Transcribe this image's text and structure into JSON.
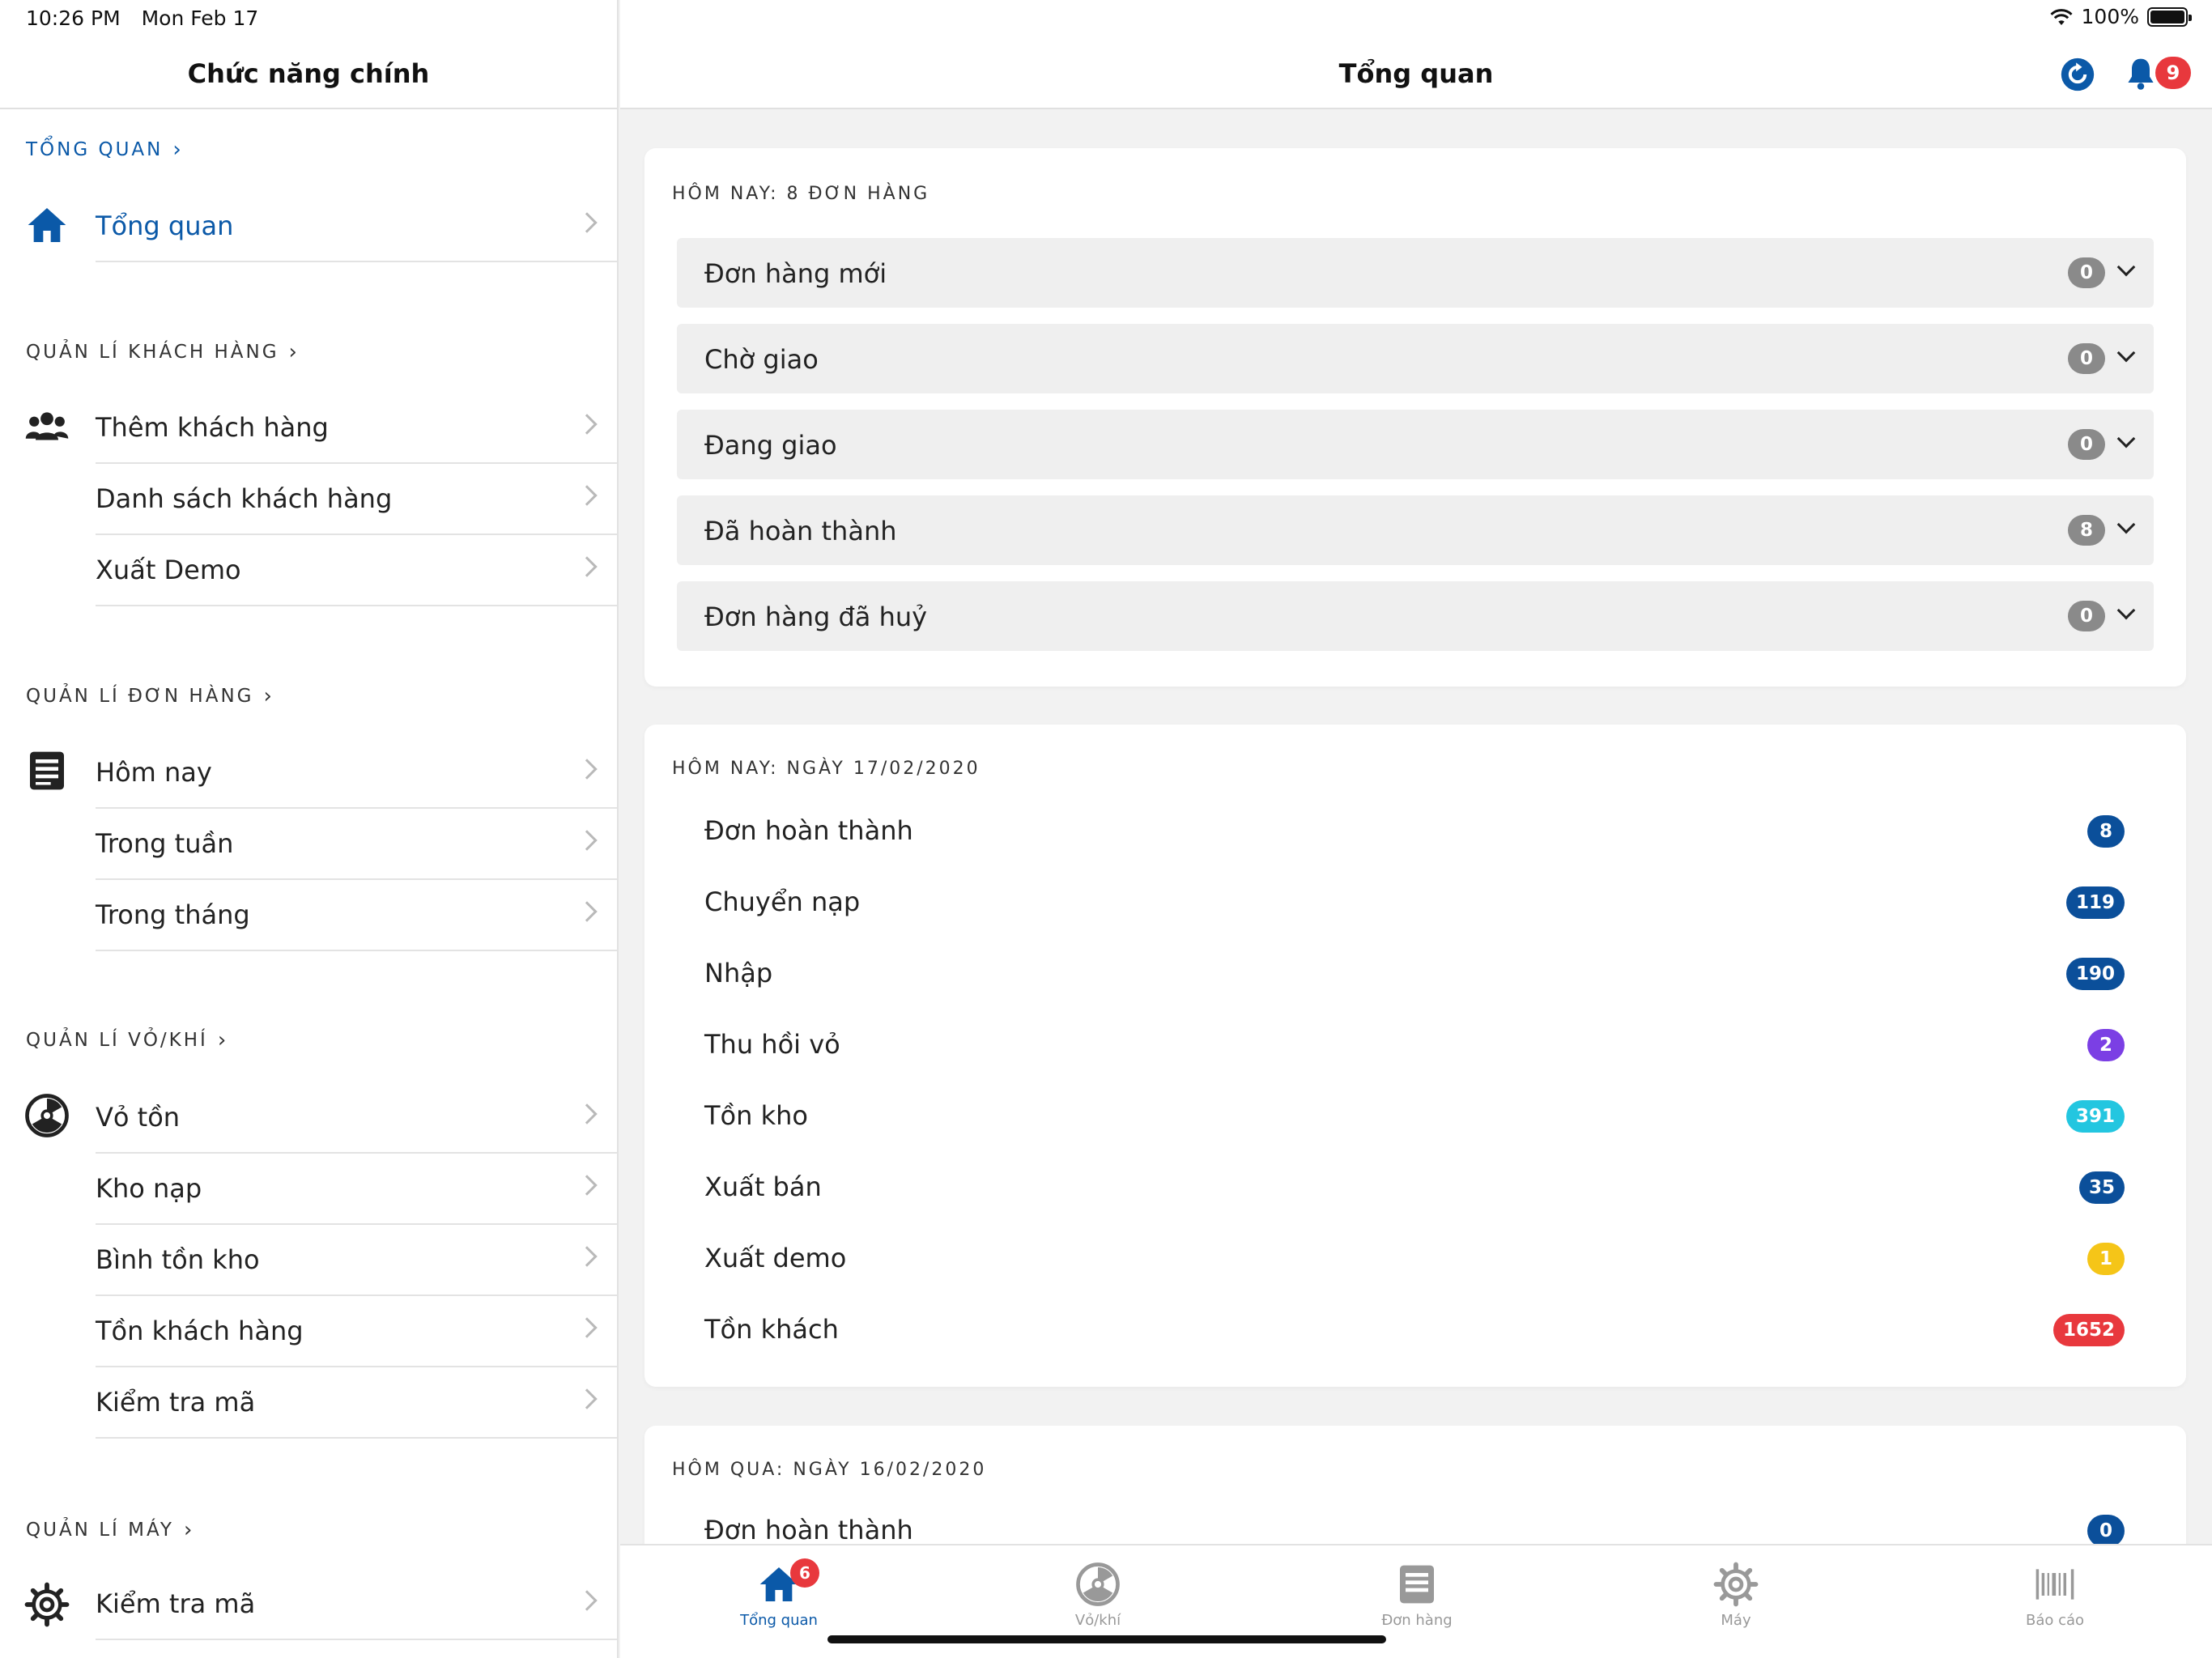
{
  "status_bar": {
    "time": "10:26 PM",
    "date": "Mon Feb 17",
    "battery": "100%"
  },
  "sidebar": {
    "title": "Chức năng chính",
    "sections": [
      {
        "title": "TỔNG QUAN",
        "items": [
          {
            "label": "Tổng quan",
            "icon": "home-icon"
          }
        ]
      },
      {
        "title": "QUẢN LÍ KHÁCH HÀNG",
        "items": [
          {
            "label": "Thêm khách hàng",
            "icon": "users-icon"
          },
          {
            "label": "Danh sách khách hàng"
          },
          {
            "label": "Xuất Demo"
          }
        ]
      },
      {
        "title": "QUẢN LÍ ĐƠN HÀNG",
        "items": [
          {
            "label": "Hôm nay",
            "icon": "list-icon"
          },
          {
            "label": "Trong tuần"
          },
          {
            "label": "Trong tháng"
          }
        ]
      },
      {
        "title": "QUẢN LÍ VỎ/KHÍ",
        "items": [
          {
            "label": "Vỏ tồn",
            "icon": "cylinder-icon"
          },
          {
            "label": "Kho nạp"
          },
          {
            "label": "Bình tồn kho"
          },
          {
            "label": "Tồn khách hàng"
          },
          {
            "label": "Kiểm tra mã"
          }
        ]
      },
      {
        "title": "QUẢN LÍ MÁY",
        "items": [
          {
            "label": "Kiểm tra mã",
            "icon": "gear-icon"
          }
        ]
      }
    ]
  },
  "header": {
    "title": "Tổng quan",
    "notification_count": "9"
  },
  "orders_today": {
    "title": "HÔM NAY: 8 ĐƠN HÀNG",
    "rows": [
      {
        "label": "Đơn hàng mới",
        "count": "0"
      },
      {
        "label": "Chờ giao",
        "count": "0"
      },
      {
        "label": "Đang giao",
        "count": "0"
      },
      {
        "label": "Đã hoàn thành",
        "count": "8"
      },
      {
        "label": "Đơn hàng đã huỷ",
        "count": "0"
      }
    ]
  },
  "stats_today": {
    "title": "HÔM NAY: NGÀY 17/02/2020",
    "rows": [
      {
        "label": "Đơn hoàn thành",
        "value": "8",
        "color": "#0b4f9a"
      },
      {
        "label": "Chuyển nạp",
        "value": "119",
        "color": "#0b4f9a"
      },
      {
        "label": "Nhập",
        "value": "190",
        "color": "#0b4f9a"
      },
      {
        "label": "Thu hồi vỏ",
        "value": "2",
        "color": "#7b3fe4"
      },
      {
        "label": "Tồn kho",
        "value": "391",
        "color": "#23c6e0"
      },
      {
        "label": "Xuất bán",
        "value": "35",
        "color": "#0b4f9a"
      },
      {
        "label": "Xuất demo",
        "value": "1",
        "color": "#f5c518"
      },
      {
        "label": "Tồn khách",
        "value": "1652",
        "color": "#e8383d"
      }
    ]
  },
  "stats_yesterday": {
    "title": "HÔM QUA: NGÀY 16/02/2020",
    "rows": [
      {
        "label": "Đơn hoàn thành",
        "value": "0",
        "color": "#0b4f9a"
      }
    ]
  },
  "tabbar": {
    "tabs": [
      {
        "label": "Tổng quan",
        "icon": "home-icon",
        "badge": "6"
      },
      {
        "label": "Vỏ/khí",
        "icon": "cylinder-icon"
      },
      {
        "label": "Đơn hàng",
        "icon": "list-icon"
      },
      {
        "label": "Máy",
        "icon": "gear-icon"
      },
      {
        "label": "Báo cáo",
        "icon": "barcode-icon"
      }
    ]
  },
  "colors": {
    "accent": "#0b59a8",
    "alert": "#e8383d",
    "row_bg": "#efefef"
  }
}
